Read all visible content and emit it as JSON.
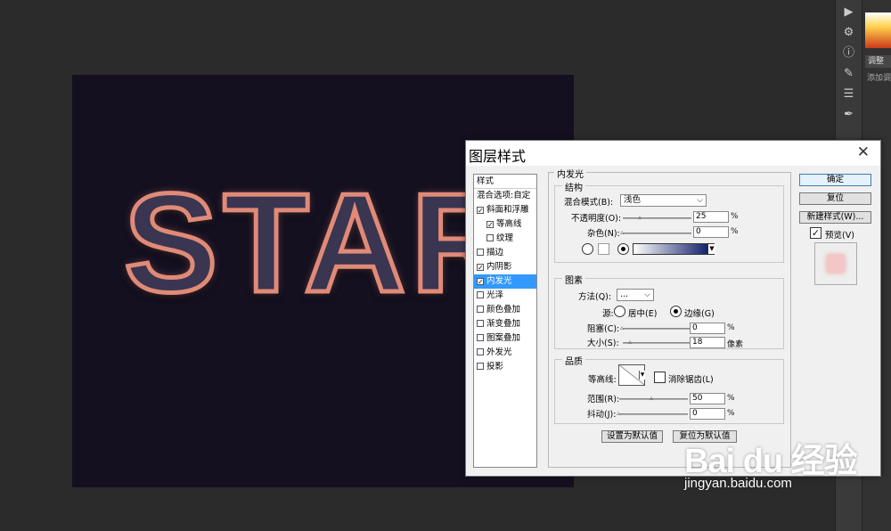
{
  "canvas": {
    "text": "STAR"
  },
  "right_panel": {
    "tab": "调整",
    "hint": "添加调"
  },
  "dialog": {
    "title": "图层样式",
    "styles_list": {
      "header": "样式",
      "items": [
        {
          "label": "混合选项:自定",
          "checkbox": null,
          "checked": false,
          "sub": false,
          "selected": false
        },
        {
          "label": "斜面和浮雕",
          "checkbox": true,
          "checked": true,
          "sub": false,
          "selected": false
        },
        {
          "label": "等高线",
          "checkbox": true,
          "checked": true,
          "sub": true,
          "selected": false
        },
        {
          "label": "纹理",
          "checkbox": true,
          "checked": false,
          "sub": true,
          "selected": false
        },
        {
          "label": "描边",
          "checkbox": true,
          "checked": false,
          "sub": false,
          "selected": false
        },
        {
          "label": "内阴影",
          "checkbox": true,
          "checked": true,
          "sub": false,
          "selected": false
        },
        {
          "label": "内发光",
          "checkbox": true,
          "checked": true,
          "sub": false,
          "selected": true
        },
        {
          "label": "光泽",
          "checkbox": true,
          "checked": false,
          "sub": false,
          "selected": false
        },
        {
          "label": "颜色叠加",
          "checkbox": true,
          "checked": false,
          "sub": false,
          "selected": false
        },
        {
          "label": "渐变叠加",
          "checkbox": true,
          "checked": false,
          "sub": false,
          "selected": false
        },
        {
          "label": "图案叠加",
          "checkbox": true,
          "checked": false,
          "sub": false,
          "selected": false
        },
        {
          "label": "外发光",
          "checkbox": true,
          "checked": false,
          "sub": false,
          "selected": false
        },
        {
          "label": "投影",
          "checkbox": true,
          "checked": false,
          "sub": false,
          "selected": false
        }
      ]
    },
    "section_title": "内发光",
    "structure": {
      "title": "结构",
      "blend_mode_label": "混合模式(B):",
      "blend_mode_value": "浅色",
      "opacity_label": "不透明度(O):",
      "opacity_value": "25",
      "noise_label": "杂色(N):",
      "noise_value": "0",
      "percent": "%"
    },
    "elements": {
      "title": "图素",
      "method_label": "方法(Q):",
      "method_value": "...",
      "source_label": "源:",
      "source_center": "居中(E)",
      "source_edge": "边缘(G)",
      "choke_label": "阻塞(C):",
      "choke_value": "0",
      "size_label": "大小(S):",
      "size_value": "18",
      "size_unit": "像素",
      "percent": "%"
    },
    "quality": {
      "title": "品质",
      "contour_label": "等高线:",
      "antialias_label": "消除锯齿(L)",
      "range_label": "范围(R):",
      "range_value": "50",
      "jitter_label": "抖动(J):",
      "jitter_value": "0",
      "percent": "%"
    },
    "set_default": "设置为默认值",
    "reset_default": "复位为默认值",
    "buttons": {
      "ok": "确定",
      "reset": "复位",
      "new_style": "新建样式(W)...",
      "preview": "预览(V)"
    }
  },
  "watermark": {
    "brand": "Bai du 经验",
    "url": "jingyan.baidu.com"
  },
  "colors": {
    "glow_stroke": "#e08a78",
    "selection": "#3399ff"
  }
}
